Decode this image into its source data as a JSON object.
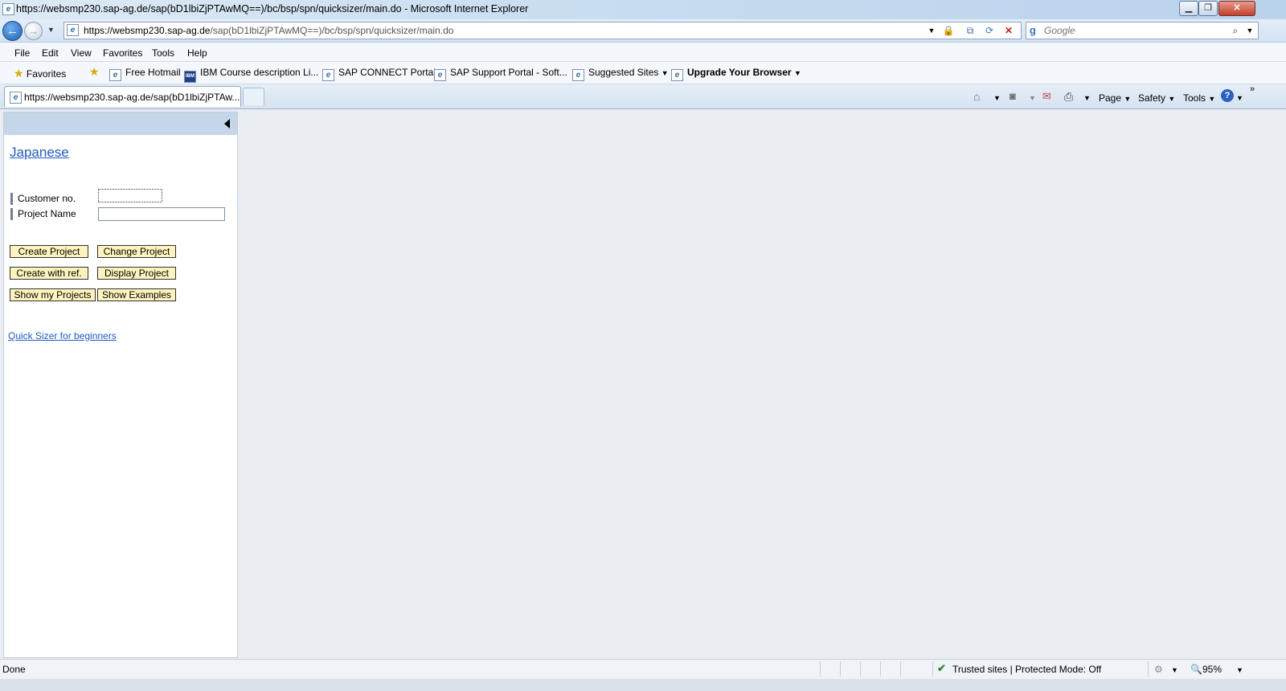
{
  "window": {
    "title": "https://websmp230.sap-ag.de/sap(bD1lbiZjPTAwMQ==)/bc/bsp/spn/quicksizer/main.do - Microsoft Internet Explorer",
    "min_glyph": "▁",
    "max_glyph": "❐",
    "close_glyph": "✕"
  },
  "address": {
    "prefix": "https://websmp230.",
    "domain": "sap-ag.de",
    "path": "/sap(bD1lbiZjPTAwMQ==)/bc/bsp/spn/quicksizer/main.do"
  },
  "search": {
    "placeholder": "Google"
  },
  "menu": [
    "File",
    "Edit",
    "View",
    "Favorites",
    "Tools",
    "Help"
  ],
  "favorites_bar": {
    "favorites_label": "Favorites",
    "items": [
      "Free Hotmail",
      "IBM Course description Li...",
      "SAP CONNECT Portal",
      "SAP Support Portal - Soft...",
      "Suggested Sites",
      "Upgrade Your Browser"
    ]
  },
  "tab": {
    "title": "https://websmp230.sap-ag.de/sap(bD1lbiZjPTAw..."
  },
  "command_bar": {
    "page": "Page",
    "safety": "Safety",
    "tools": "Tools"
  },
  "panel": {
    "language_link": "Japanese",
    "customer_label": "Customer no.",
    "customer_value": "",
    "project_label": "Project Name",
    "project_value": "",
    "buttons": {
      "create_project": "Create Project",
      "change_project": "Change Project",
      "create_with_ref": "Create with ref.",
      "display_project": "Display Project",
      "show_my_projects": "Show my Projects",
      "show_examples": "Show Examples"
    },
    "beginner_link": "Quick Sizer for beginners"
  },
  "status": {
    "left": "Done",
    "zone": "Trusted sites | Protected Mode: Off",
    "zoom": "95%"
  },
  "colors": {
    "accent": "#1f5bc6",
    "button_bg": "#fdf4bd",
    "panel_header": "#c5d6ea"
  }
}
